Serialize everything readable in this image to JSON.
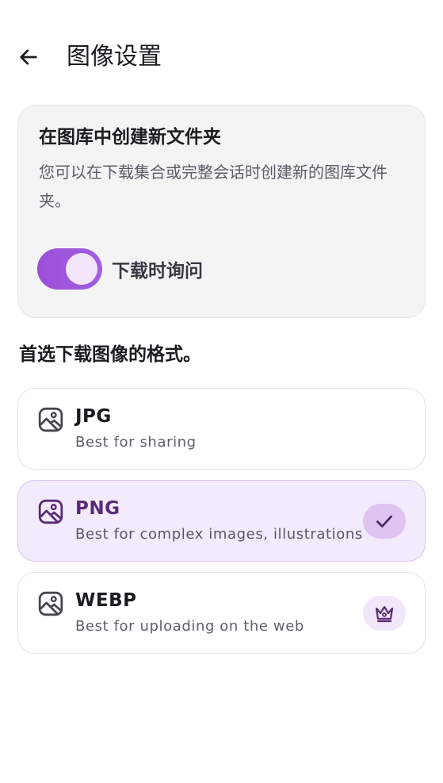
{
  "header": {
    "title": "图像设置"
  },
  "folder_card": {
    "title": "在图库中创建新文件夹",
    "description": "您可以在下载集合或完整会话时创建新的图库文件夹。",
    "toggle_label": "下载时询问",
    "toggle_on": true
  },
  "format_section": {
    "heading": "首选下载图像的格式。",
    "options": [
      {
        "name": "JPG",
        "description": "Best for sharing",
        "selected": false,
        "icon": "image-icon"
      },
      {
        "name": "PNG",
        "description": "Best for complex images, illustrations",
        "selected": true,
        "icon": "image-icon",
        "badge": "check-icon"
      },
      {
        "name": "WEBP",
        "description": "Best for uploading on the web",
        "selected": false,
        "icon": "image-icon",
        "badge": "crown-icon"
      }
    ]
  },
  "colors": {
    "accent": "#9a4fd8",
    "selected_background": "#f3eafc",
    "selected_text": "#5a2a76"
  }
}
